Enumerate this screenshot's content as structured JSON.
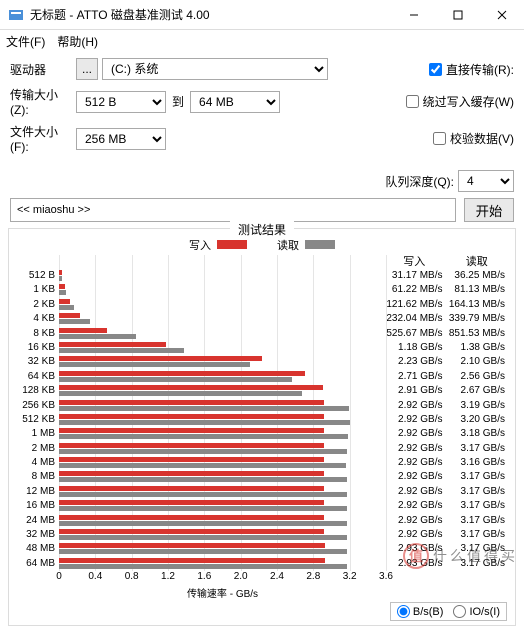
{
  "window": {
    "title": "无标题 - ATTO 磁盘基准测试 4.00"
  },
  "menu": {
    "file": "文件(F)",
    "help": "帮助(H)"
  },
  "labels": {
    "drive": "驱动器",
    "drive_value": "(C:) 系统",
    "xfer": "传输大小(Z):",
    "xfer_from": "512 B",
    "to": "到",
    "xfer_to": "64 MB",
    "filesize": "文件大小(F):",
    "filesize_value": "256 MB"
  },
  "checks": {
    "direct": "直接传输(R):",
    "direct_checked": true,
    "bypass": "绕过写入缓存(W)",
    "bypass_checked": false,
    "verify": "校验数据(V)",
    "verify_checked": false
  },
  "queue": {
    "label": "队列深度(Q):",
    "value": "4"
  },
  "desc": "<< miaoshu >>",
  "run": "开始",
  "results_title": "测试结果",
  "legend": {
    "write": "写入",
    "read": "读取"
  },
  "colors": {
    "write": "#d8342e",
    "read": "#888888"
  },
  "xaxis": {
    "label": "传输速率 - GB/s",
    "max_gbps": 3.6,
    "ticks": [
      "0",
      "0.4",
      "0.8",
      "1.2",
      "1.6",
      "2.0",
      "2.4",
      "2.8",
      "3.2",
      "3.6"
    ]
  },
  "columns": {
    "write": "写入",
    "read": "读取"
  },
  "units_footer": {
    "bs": "B/s(B)",
    "ios": "IO/s(I)",
    "selected": "bs"
  },
  "watermark": {
    "badge": "值",
    "text": "什么值得买"
  },
  "chart_data": {
    "type": "bar",
    "xlabel": "传输速率 - GB/s",
    "xlim": [
      0,
      3.6
    ],
    "categories": [
      "512 B",
      "1 KB",
      "2 KB",
      "4 KB",
      "8 KB",
      "16 KB",
      "32 KB",
      "64 KB",
      "128 KB",
      "256 KB",
      "512 KB",
      "1 MB",
      "2 MB",
      "4 MB",
      "8 MB",
      "12 MB",
      "16 MB",
      "24 MB",
      "32 MB",
      "48 MB",
      "64 MB"
    ],
    "series": [
      {
        "name": "写入",
        "display": [
          "31.17 MB/s",
          "61.22 MB/s",
          "121.62 MB/s",
          "232.04 MB/s",
          "525.67 MB/s",
          "1.18 GB/s",
          "2.23 GB/s",
          "2.71 GB/s",
          "2.91 GB/s",
          "2.92 GB/s",
          "2.92 GB/s",
          "2.92 GB/s",
          "2.92 GB/s",
          "2.92 GB/s",
          "2.92 GB/s",
          "2.92 GB/s",
          "2.92 GB/s",
          "2.92 GB/s",
          "2.92 GB/s",
          "2.93 GB/s",
          "2.93 GB/s"
        ],
        "gbps": [
          0.03117,
          0.06122,
          0.12162,
          0.23204,
          0.52567,
          1.18,
          2.23,
          2.71,
          2.91,
          2.92,
          2.92,
          2.92,
          2.92,
          2.92,
          2.92,
          2.92,
          2.92,
          2.92,
          2.92,
          2.93,
          2.93
        ]
      },
      {
        "name": "读取",
        "display": [
          "36.25 MB/s",
          "81.13 MB/s",
          "164.13 MB/s",
          "339.79 MB/s",
          "851.53 MB/s",
          "1.38 GB/s",
          "2.10 GB/s",
          "2.56 GB/s",
          "2.67 GB/s",
          "3.19 GB/s",
          "3.20 GB/s",
          "3.18 GB/s",
          "3.17 GB/s",
          "3.16 GB/s",
          "3.17 GB/s",
          "3.17 GB/s",
          "3.17 GB/s",
          "3.17 GB/s",
          "3.17 GB/s",
          "3.17 GB/s",
          "3.17 GB/s"
        ],
        "gbps": [
          0.03625,
          0.08113,
          0.16413,
          0.33979,
          0.85153,
          1.38,
          2.1,
          2.56,
          2.67,
          3.19,
          3.2,
          3.18,
          3.17,
          3.16,
          3.17,
          3.17,
          3.17,
          3.17,
          3.17,
          3.17,
          3.17
        ]
      }
    ]
  }
}
